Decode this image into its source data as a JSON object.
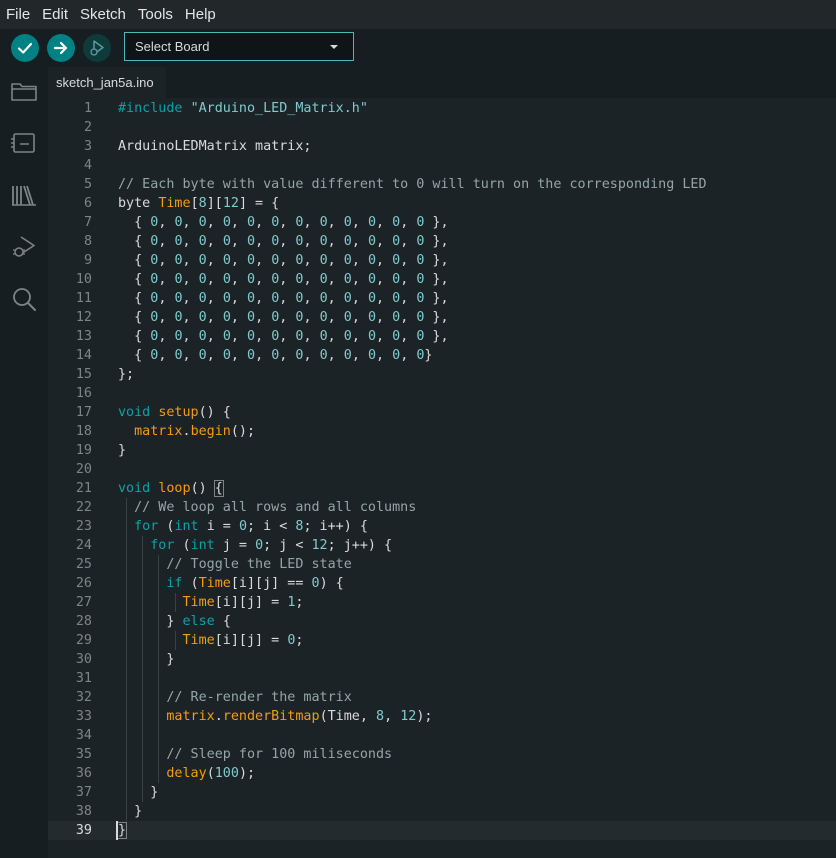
{
  "menu": [
    "File",
    "Edit",
    "Sketch",
    "Tools",
    "Help"
  ],
  "toolbar": {
    "verify_icon": "checkmark-icon",
    "upload_icon": "arrow-right-icon",
    "debug_icon": "debug-icon",
    "board_select": "Select Board"
  },
  "sidebar": {
    "icons": [
      "folder-icon",
      "board-manager-icon",
      "library-icon",
      "debug-icon",
      "search-icon"
    ]
  },
  "tab": {
    "filename": "sketch_jan5a.ino"
  },
  "colors": {
    "accent": "#008184",
    "keyword": "#0ca1a6",
    "function": "#f39c12",
    "comment": "#95a5a6",
    "text": "#dadada"
  },
  "editor": {
    "active_line": 39,
    "lines": [
      [
        [
          "#include ",
          "k"
        ],
        [
          "\"Arduino_LED_Matrix.h\"",
          "s"
        ]
      ],
      [],
      [
        [
          "ArduinoLEDMatrix matrix;",
          "p"
        ]
      ],
      [],
      [
        [
          "// Each byte with value different to 0 will turn on the corresponding LED",
          "c"
        ]
      ],
      [
        [
          "byte ",
          "p"
        ],
        [
          "Time",
          "f"
        ],
        [
          "[",
          "p"
        ],
        [
          "8",
          "n"
        ],
        [
          "][",
          "p"
        ],
        [
          "12",
          "n"
        ],
        [
          "] = {",
          "p"
        ]
      ],
      [
        [
          "  { ",
          "p"
        ],
        [
          "0",
          "n"
        ],
        [
          ", ",
          "p"
        ],
        [
          "0",
          "n"
        ],
        [
          ", ",
          "p"
        ],
        [
          "0",
          "n"
        ],
        [
          ", ",
          "p"
        ],
        [
          "0",
          "n"
        ],
        [
          ", ",
          "p"
        ],
        [
          "0",
          "n"
        ],
        [
          ", ",
          "p"
        ],
        [
          "0",
          "n"
        ],
        [
          ", ",
          "p"
        ],
        [
          "0",
          "n"
        ],
        [
          ", ",
          "p"
        ],
        [
          "0",
          "n"
        ],
        [
          ", ",
          "p"
        ],
        [
          "0",
          "n"
        ],
        [
          ", ",
          "p"
        ],
        [
          "0",
          "n"
        ],
        [
          ", ",
          "p"
        ],
        [
          "0",
          "n"
        ],
        [
          ", ",
          "p"
        ],
        [
          "0",
          "n"
        ],
        [
          " },",
          "p"
        ]
      ],
      [
        [
          "  { ",
          "p"
        ],
        [
          "0",
          "n"
        ],
        [
          ", ",
          "p"
        ],
        [
          "0",
          "n"
        ],
        [
          ", ",
          "p"
        ],
        [
          "0",
          "n"
        ],
        [
          ", ",
          "p"
        ],
        [
          "0",
          "n"
        ],
        [
          ", ",
          "p"
        ],
        [
          "0",
          "n"
        ],
        [
          ", ",
          "p"
        ],
        [
          "0",
          "n"
        ],
        [
          ", ",
          "p"
        ],
        [
          "0",
          "n"
        ],
        [
          ", ",
          "p"
        ],
        [
          "0",
          "n"
        ],
        [
          ", ",
          "p"
        ],
        [
          "0",
          "n"
        ],
        [
          ", ",
          "p"
        ],
        [
          "0",
          "n"
        ],
        [
          ", ",
          "p"
        ],
        [
          "0",
          "n"
        ],
        [
          ", ",
          "p"
        ],
        [
          "0",
          "n"
        ],
        [
          " },",
          "p"
        ]
      ],
      [
        [
          "  { ",
          "p"
        ],
        [
          "0",
          "n"
        ],
        [
          ", ",
          "p"
        ],
        [
          "0",
          "n"
        ],
        [
          ", ",
          "p"
        ],
        [
          "0",
          "n"
        ],
        [
          ", ",
          "p"
        ],
        [
          "0",
          "n"
        ],
        [
          ", ",
          "p"
        ],
        [
          "0",
          "n"
        ],
        [
          ", ",
          "p"
        ],
        [
          "0",
          "n"
        ],
        [
          ", ",
          "p"
        ],
        [
          "0",
          "n"
        ],
        [
          ", ",
          "p"
        ],
        [
          "0",
          "n"
        ],
        [
          ", ",
          "p"
        ],
        [
          "0",
          "n"
        ],
        [
          ", ",
          "p"
        ],
        [
          "0",
          "n"
        ],
        [
          ", ",
          "p"
        ],
        [
          "0",
          "n"
        ],
        [
          ", ",
          "p"
        ],
        [
          "0",
          "n"
        ],
        [
          " },",
          "p"
        ]
      ],
      [
        [
          "  { ",
          "p"
        ],
        [
          "0",
          "n"
        ],
        [
          ", ",
          "p"
        ],
        [
          "0",
          "n"
        ],
        [
          ", ",
          "p"
        ],
        [
          "0",
          "n"
        ],
        [
          ", ",
          "p"
        ],
        [
          "0",
          "n"
        ],
        [
          ", ",
          "p"
        ],
        [
          "0",
          "n"
        ],
        [
          ", ",
          "p"
        ],
        [
          "0",
          "n"
        ],
        [
          ", ",
          "p"
        ],
        [
          "0",
          "n"
        ],
        [
          ", ",
          "p"
        ],
        [
          "0",
          "n"
        ],
        [
          ", ",
          "p"
        ],
        [
          "0",
          "n"
        ],
        [
          ", ",
          "p"
        ],
        [
          "0",
          "n"
        ],
        [
          ", ",
          "p"
        ],
        [
          "0",
          "n"
        ],
        [
          ", ",
          "p"
        ],
        [
          "0",
          "n"
        ],
        [
          " },",
          "p"
        ]
      ],
      [
        [
          "  { ",
          "p"
        ],
        [
          "0",
          "n"
        ],
        [
          ", ",
          "p"
        ],
        [
          "0",
          "n"
        ],
        [
          ", ",
          "p"
        ],
        [
          "0",
          "n"
        ],
        [
          ", ",
          "p"
        ],
        [
          "0",
          "n"
        ],
        [
          ", ",
          "p"
        ],
        [
          "0",
          "n"
        ],
        [
          ", ",
          "p"
        ],
        [
          "0",
          "n"
        ],
        [
          ", ",
          "p"
        ],
        [
          "0",
          "n"
        ],
        [
          ", ",
          "p"
        ],
        [
          "0",
          "n"
        ],
        [
          ", ",
          "p"
        ],
        [
          "0",
          "n"
        ],
        [
          ", ",
          "p"
        ],
        [
          "0",
          "n"
        ],
        [
          ", ",
          "p"
        ],
        [
          "0",
          "n"
        ],
        [
          ", ",
          "p"
        ],
        [
          "0",
          "n"
        ],
        [
          " },",
          "p"
        ]
      ],
      [
        [
          "  { ",
          "p"
        ],
        [
          "0",
          "n"
        ],
        [
          ", ",
          "p"
        ],
        [
          "0",
          "n"
        ],
        [
          ", ",
          "p"
        ],
        [
          "0",
          "n"
        ],
        [
          ", ",
          "p"
        ],
        [
          "0",
          "n"
        ],
        [
          ", ",
          "p"
        ],
        [
          "0",
          "n"
        ],
        [
          ", ",
          "p"
        ],
        [
          "0",
          "n"
        ],
        [
          ", ",
          "p"
        ],
        [
          "0",
          "n"
        ],
        [
          ", ",
          "p"
        ],
        [
          "0",
          "n"
        ],
        [
          ", ",
          "p"
        ],
        [
          "0",
          "n"
        ],
        [
          ", ",
          "p"
        ],
        [
          "0",
          "n"
        ],
        [
          ", ",
          "p"
        ],
        [
          "0",
          "n"
        ],
        [
          ", ",
          "p"
        ],
        [
          "0",
          "n"
        ],
        [
          " },",
          "p"
        ]
      ],
      [
        [
          "  { ",
          "p"
        ],
        [
          "0",
          "n"
        ],
        [
          ", ",
          "p"
        ],
        [
          "0",
          "n"
        ],
        [
          ", ",
          "p"
        ],
        [
          "0",
          "n"
        ],
        [
          ", ",
          "p"
        ],
        [
          "0",
          "n"
        ],
        [
          ", ",
          "p"
        ],
        [
          "0",
          "n"
        ],
        [
          ", ",
          "p"
        ],
        [
          "0",
          "n"
        ],
        [
          ", ",
          "p"
        ],
        [
          "0",
          "n"
        ],
        [
          ", ",
          "p"
        ],
        [
          "0",
          "n"
        ],
        [
          ", ",
          "p"
        ],
        [
          "0",
          "n"
        ],
        [
          ", ",
          "p"
        ],
        [
          "0",
          "n"
        ],
        [
          ", ",
          "p"
        ],
        [
          "0",
          "n"
        ],
        [
          ", ",
          "p"
        ],
        [
          "0",
          "n"
        ],
        [
          " },",
          "p"
        ]
      ],
      [
        [
          "  { ",
          "p"
        ],
        [
          "0",
          "n"
        ],
        [
          ", ",
          "p"
        ],
        [
          "0",
          "n"
        ],
        [
          ", ",
          "p"
        ],
        [
          "0",
          "n"
        ],
        [
          ", ",
          "p"
        ],
        [
          "0",
          "n"
        ],
        [
          ", ",
          "p"
        ],
        [
          "0",
          "n"
        ],
        [
          ", ",
          "p"
        ],
        [
          "0",
          "n"
        ],
        [
          ", ",
          "p"
        ],
        [
          "0",
          "n"
        ],
        [
          ", ",
          "p"
        ],
        [
          "0",
          "n"
        ],
        [
          ", ",
          "p"
        ],
        [
          "0",
          "n"
        ],
        [
          ", ",
          "p"
        ],
        [
          "0",
          "n"
        ],
        [
          ", ",
          "p"
        ],
        [
          "0",
          "n"
        ],
        [
          ", ",
          "p"
        ],
        [
          "0",
          "n"
        ],
        [
          "}",
          "p"
        ]
      ],
      [
        [
          "};",
          "p"
        ]
      ],
      [],
      [
        [
          "void ",
          "k"
        ],
        [
          "setup",
          "f"
        ],
        [
          "() {",
          "p"
        ]
      ],
      [
        [
          "  ",
          "p"
        ],
        [
          "matrix",
          "f"
        ],
        [
          ".",
          "p"
        ],
        [
          "begin",
          "f"
        ],
        [
          "();",
          "p"
        ]
      ],
      [
        [
          "}",
          "p"
        ]
      ],
      [],
      [
        [
          "void ",
          "k"
        ],
        [
          "loop",
          "f"
        ],
        [
          "() ",
          "p"
        ],
        [
          "{",
          "hl"
        ]
      ],
      [
        [
          "  // We loop all rows and all columns",
          "c"
        ]
      ],
      [
        [
          "  ",
          "p"
        ],
        [
          "for ",
          "k"
        ],
        [
          "(",
          "p"
        ],
        [
          "int ",
          "k"
        ],
        [
          "i = ",
          "p"
        ],
        [
          "0",
          "n"
        ],
        [
          "; i < ",
          "p"
        ],
        [
          "8",
          "n"
        ],
        [
          "; i++) {",
          "p"
        ]
      ],
      [
        [
          "    ",
          "p"
        ],
        [
          "for ",
          "k"
        ],
        [
          "(",
          "p"
        ],
        [
          "int ",
          "k"
        ],
        [
          "j = ",
          "p"
        ],
        [
          "0",
          "n"
        ],
        [
          "; j < ",
          "p"
        ],
        [
          "12",
          "n"
        ],
        [
          "; j++) {",
          "p"
        ]
      ],
      [
        [
          "      // Toggle the LED state",
          "c"
        ]
      ],
      [
        [
          "      ",
          "p"
        ],
        [
          "if ",
          "k"
        ],
        [
          "(",
          "p"
        ],
        [
          "Time",
          "f"
        ],
        [
          "[i][j] == ",
          "p"
        ],
        [
          "0",
          "n"
        ],
        [
          ") {",
          "p"
        ]
      ],
      [
        [
          "        ",
          "p"
        ],
        [
          "Time",
          "f"
        ],
        [
          "[i][j] = ",
          "p"
        ],
        [
          "1",
          "n"
        ],
        [
          ";",
          "p"
        ]
      ],
      [
        [
          "      } ",
          "p"
        ],
        [
          "else ",
          "k"
        ],
        [
          "{",
          "p"
        ]
      ],
      [
        [
          "        ",
          "p"
        ],
        [
          "Time",
          "f"
        ],
        [
          "[i][j] = ",
          "p"
        ],
        [
          "0",
          "n"
        ],
        [
          ";",
          "p"
        ]
      ],
      [
        [
          "      }",
          "p"
        ]
      ],
      [],
      [
        [
          "      // Re-render the matrix",
          "c"
        ]
      ],
      [
        [
          "      ",
          "p"
        ],
        [
          "matrix",
          "f"
        ],
        [
          ".",
          "p"
        ],
        [
          "renderBitmap",
          "f"
        ],
        [
          "(Time, ",
          "p"
        ],
        [
          "8",
          "n"
        ],
        [
          ", ",
          "p"
        ],
        [
          "12",
          "n"
        ],
        [
          ");",
          "p"
        ]
      ],
      [],
      [
        [
          "      // Sleep for 100 miliseconds",
          "c"
        ]
      ],
      [
        [
          "      ",
          "p"
        ],
        [
          "delay",
          "f"
        ],
        [
          "(",
          "p"
        ],
        [
          "100",
          "n"
        ],
        [
          ");",
          "p"
        ]
      ],
      [
        [
          "    }",
          "p"
        ]
      ],
      [
        [
          "  }",
          "p"
        ]
      ],
      [
        [
          "}",
          "hl"
        ]
      ]
    ]
  }
}
